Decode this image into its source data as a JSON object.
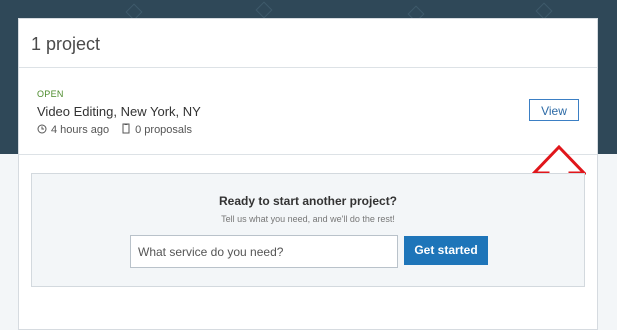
{
  "card": {
    "title": "1 project"
  },
  "project": {
    "status": "OPEN",
    "title": "Video Editing, New York, NY",
    "time_ago": "4 hours ago",
    "proposals": "0 proposals",
    "view_label": "View"
  },
  "cta": {
    "heading": "Ready to start another project?",
    "subheading": "Tell us what you need, and we'll do the rest!",
    "input_placeholder": "What service do you need?",
    "button_label": "Get started"
  },
  "colors": {
    "header_bg": "#2f4858",
    "status_green": "#4a8a2a",
    "primary_blue": "#1e75b9",
    "arrow_red": "#e0161b"
  },
  "icons": {
    "clock": "clock-icon",
    "document": "document-icon",
    "arrow": "up-arrow-icon"
  }
}
